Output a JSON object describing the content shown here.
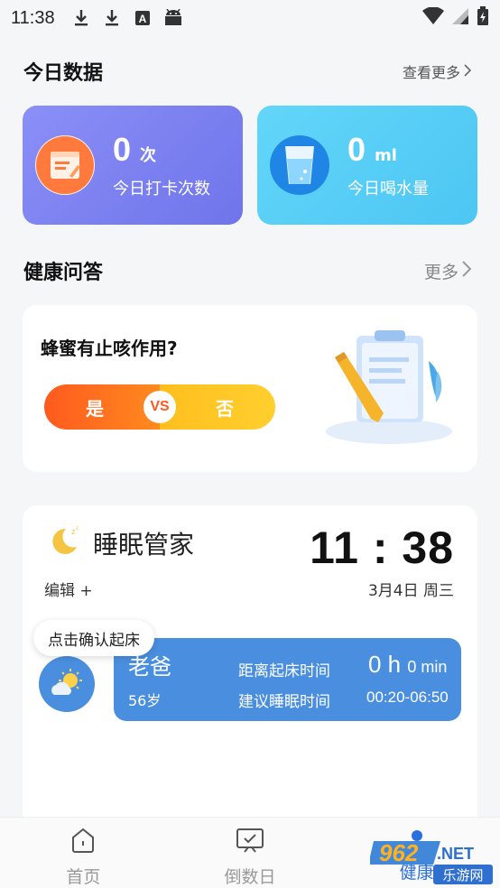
{
  "status_bar": {
    "time": "11:38",
    "icons": [
      "download-icon",
      "download-icon",
      "a-letter-icon",
      "android-icon"
    ],
    "right_icons": [
      "wifi-icon",
      "signal-icon",
      "battery-icon"
    ]
  },
  "today": {
    "title": "今日数据",
    "more": "查看更多",
    "checkin": {
      "value": "0",
      "unit": "次",
      "label": "今日打卡次数",
      "icon": "calendar-note-icon"
    },
    "water": {
      "value": "0",
      "unit": "ml",
      "label": "今日喝水量",
      "icon": "water-glass-icon"
    }
  },
  "health_qa": {
    "title": "健康问答",
    "more": "更多",
    "question": "蜂蜜有止咳作用?",
    "yes_label": "是",
    "vs_label": "VS",
    "no_label": "否",
    "illustration": "clipboard-pencil-icon"
  },
  "sleep": {
    "title": "睡眠管家",
    "clock": "11 : 38",
    "edit": "编辑 +",
    "date": "3月4日 周三",
    "tooltip": "点击确认起床",
    "person": {
      "name": "老爸",
      "age": "56岁",
      "wake_label": "距离起床时间",
      "wake_hours": "0 h",
      "wake_minutes": "0 min",
      "suggest_label": "建议睡眠时间",
      "suggest_range": "00:20-06:50"
    }
  },
  "nav": {
    "items": [
      {
        "label": "首页",
        "icon": "home-icon"
      },
      {
        "label": "倒数日",
        "icon": "calendar-check-icon"
      },
      {
        "label": "健康",
        "icon": "health-icon"
      }
    ]
  },
  "watermark": {
    "text1": "962",
    "text2": ".NET",
    "text3": "乐游网"
  },
  "colors": {
    "purple": "#7a7ef2",
    "cyan": "#55cdf7",
    "orange": "#ff6a1e",
    "yellow": "#ffc61e",
    "blue": "#4a8fdf"
  }
}
